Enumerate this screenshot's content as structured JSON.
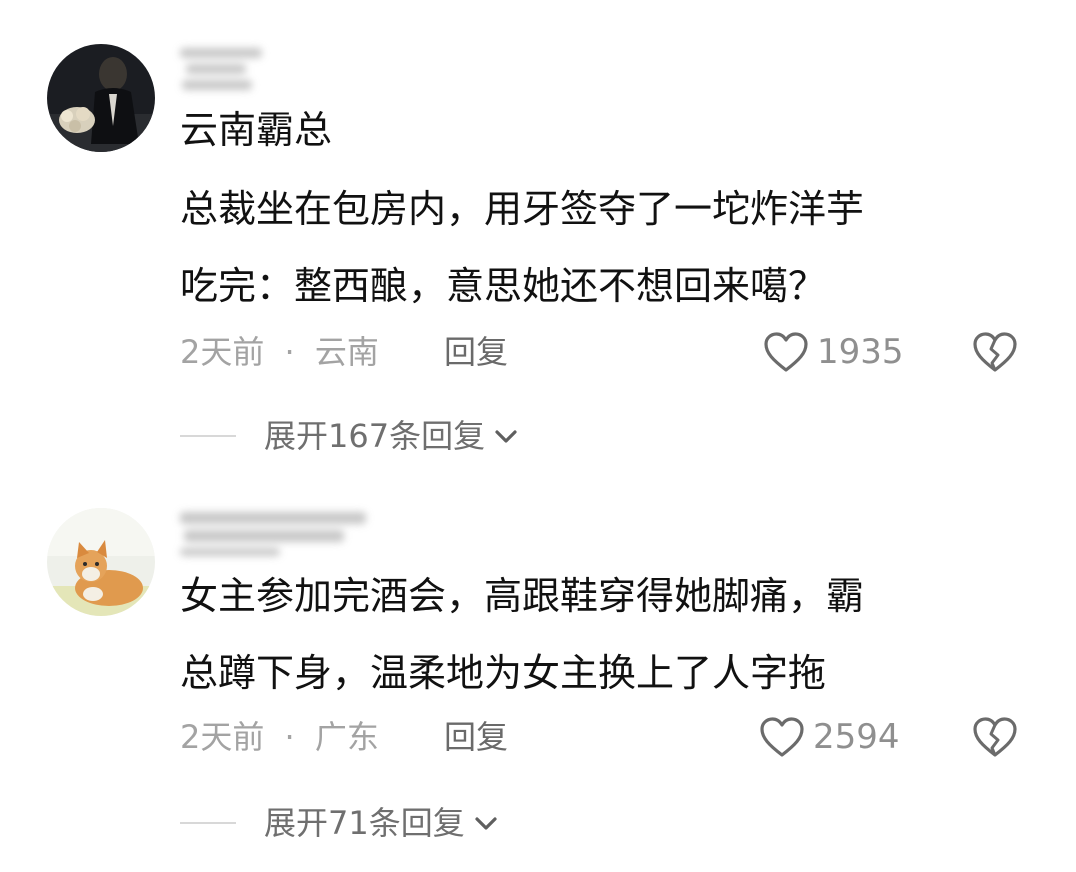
{
  "comments": [
    {
      "username": "云南霸总",
      "lines": [
        "总裁坐在包房内，用牙签夺了一坨炸洋芋",
        "吃完：整西酿，意思她还不想回来噶？"
      ],
      "time": "2天前",
      "separator": "·",
      "location": "云南",
      "reply_label": "回复",
      "likes": "1935",
      "expand_label": "展开167条回复",
      "avatar": "avatar-man-dark",
      "icons": {
        "like": "heart-outline-icon",
        "dislike": "broken-heart-icon",
        "expand": "chevron-down-icon"
      }
    },
    {
      "username": "",
      "lines": [
        "女主参加完酒会，高跟鞋穿得她脚痛，霸",
        "总蹲下身，温柔地为女主换上了人字拖"
      ],
      "time": "2天前",
      "separator": "·",
      "location": "广东",
      "reply_label": "回复",
      "likes": "2594",
      "expand_label": "展开71条回复",
      "avatar": "avatar-orange-cat",
      "icons": {
        "like": "heart-outline-icon",
        "dislike": "broken-heart-icon",
        "expand": "chevron-down-icon"
      }
    }
  ],
  "colors": {
    "primary_text": "#111111",
    "meta_text": "#a3a3a3",
    "reply_text": "#6a6a6a",
    "icon": "#6b6b6b",
    "background": "#ffffff"
  }
}
